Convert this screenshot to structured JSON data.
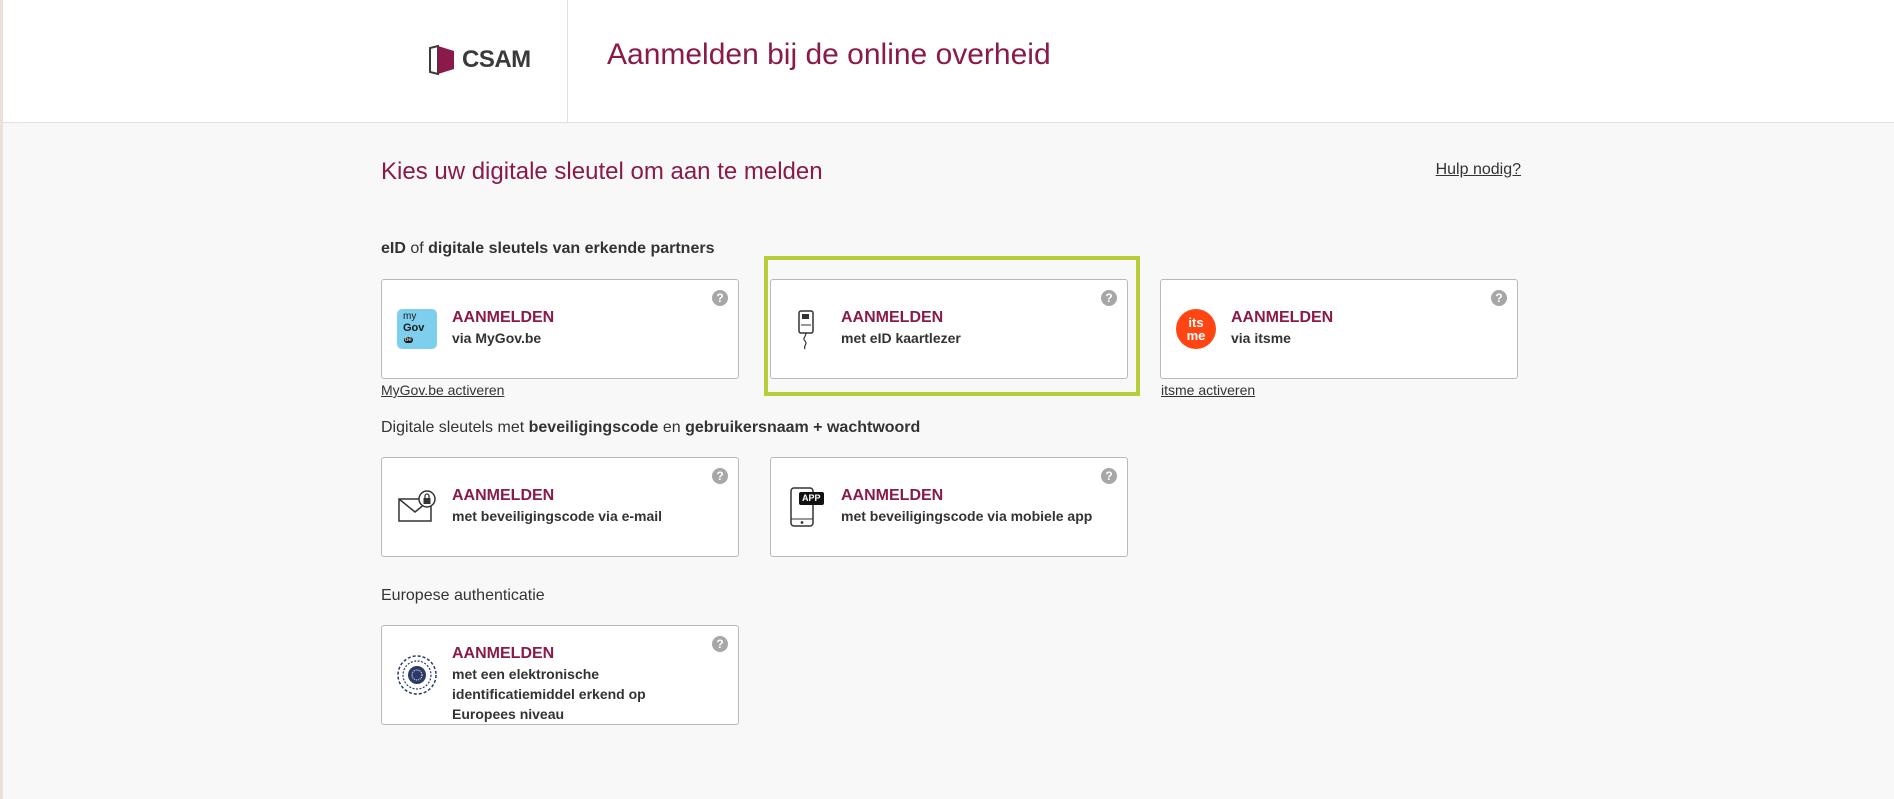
{
  "header": {
    "logo_text": "CSAM",
    "title": "Aanmelden bij de online overheid"
  },
  "main": {
    "title": "Kies uw digitale sleutel om aan te melden",
    "help_link": "Hulp nodig?"
  },
  "sections": {
    "eid": {
      "part1": "eID",
      "part2": " of ",
      "part3": "digitale sleutels van erkende partners"
    },
    "code": {
      "part1": "Digitale sleutels met ",
      "part2": "beveiligingscode",
      "part3": " en ",
      "part4": "gebruikersnaam + wachtwoord"
    },
    "european": {
      "label": "Europese authenticatie"
    }
  },
  "cards": {
    "mygov": {
      "title": "AANMELDEN",
      "subtitle": "via MyGov.be",
      "icon_line1": "my",
      "icon_line2": "Gov",
      "icon_line3": "be"
    },
    "eid_reader": {
      "title": "AANMELDEN",
      "subtitle": "met eID kaartlezer"
    },
    "itsme": {
      "title": "AANMELDEN",
      "subtitle": "via itsme",
      "icon_line1": "its",
      "icon_line2": "me"
    },
    "email_code": {
      "title": "AANMELDEN",
      "subtitle": "met beveiligingscode via e-mail"
    },
    "app_code": {
      "title": "AANMELDEN",
      "subtitle": "met beveiligingscode via mobiele app",
      "icon_badge": "APP"
    },
    "european_id": {
      "title": "AANMELDEN",
      "subtitle": "met een elektronische identificatiemiddel erkend op Europees niveau"
    }
  },
  "links": {
    "mygov_activate": "MyGov.be activeren",
    "itsme_activate": "itsme activeren"
  },
  "help_glyph": "?",
  "colors": {
    "brand": "#8a1a4a",
    "highlight": "#b7cc37",
    "itsme": "#ff4612",
    "mygov": "#7ecfee"
  }
}
